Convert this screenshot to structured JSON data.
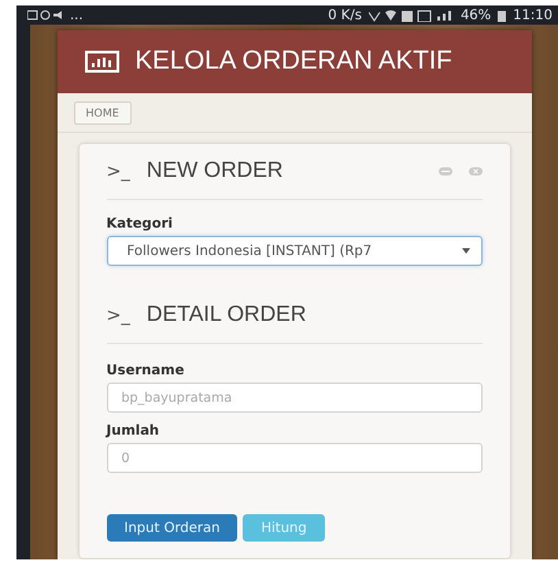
{
  "status_bar": {
    "notifications": "...",
    "speed": "0 K/s",
    "battery": "46%",
    "time": "11:10"
  },
  "header": {
    "title": "KELOLA ORDERAN AKTIF"
  },
  "breadcrumb": [
    {
      "label": "HOME"
    }
  ],
  "new_order": {
    "title": "NEW ORDER",
    "prompt": ">_",
    "category_label": "Kategori",
    "category_value": "Followers Indonesia [INSTANT] (Rp7"
  },
  "detail_order": {
    "title": "DETAIL ORDER",
    "prompt": ">_",
    "fields": [
      {
        "label": "Username",
        "placeholder": "bp_bayupratama"
      },
      {
        "label": "Jumlah",
        "placeholder": "0"
      }
    ]
  },
  "buttons": [
    {
      "label": "Input Orderan",
      "kind": "primary"
    },
    {
      "label": "Hitung",
      "kind": "info"
    }
  ]
}
